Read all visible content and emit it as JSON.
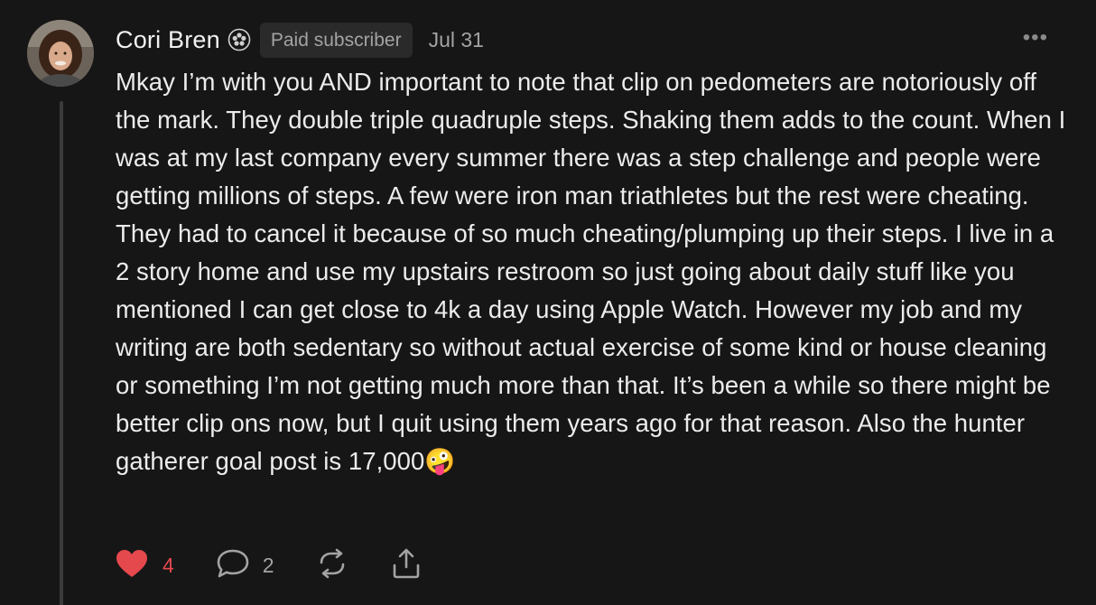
{
  "comment": {
    "author": "Cori Bren",
    "badge_icon": "founding-subscriber-badge-icon",
    "subscriber_badge": "Paid subscriber",
    "date": "Jul 31",
    "more_menu": "•••",
    "body": "Mkay I’m with you AND important to note that clip on pedometers are notoriously off the mark. They double triple quadruple steps. Shaking them adds to the count. When I was at my last company every summer there was a step challenge and people were getting millions of steps. A few were iron man triathletes but the rest were cheating. They had to cancel it because of so much cheating/plumping up their steps. I live in a 2 story home and use my upstairs restroom so just going about daily stuff like you mentioned I can get close to 4k a day using Apple Watch. However my job and my writing are both sedentary so without actual exercise of some kind or house cleaning or something I’m not getting much more than that. It’s been a while so there might be better clip ons now, but I quit using them years ago for that reason. Also the hunter gatherer goal post is 17,000🤪"
  },
  "actions": {
    "like_icon": "heart-icon",
    "like_count": "4",
    "reply_icon": "speech-bubble-icon",
    "reply_count": "2",
    "restack_icon": "restack-icon",
    "share_icon": "share-icon"
  },
  "colors": {
    "background": "#161616",
    "text": "#ececec",
    "muted": "#a3a3a3",
    "like": "#e5484d",
    "badge_bg": "#2a2a2a"
  }
}
